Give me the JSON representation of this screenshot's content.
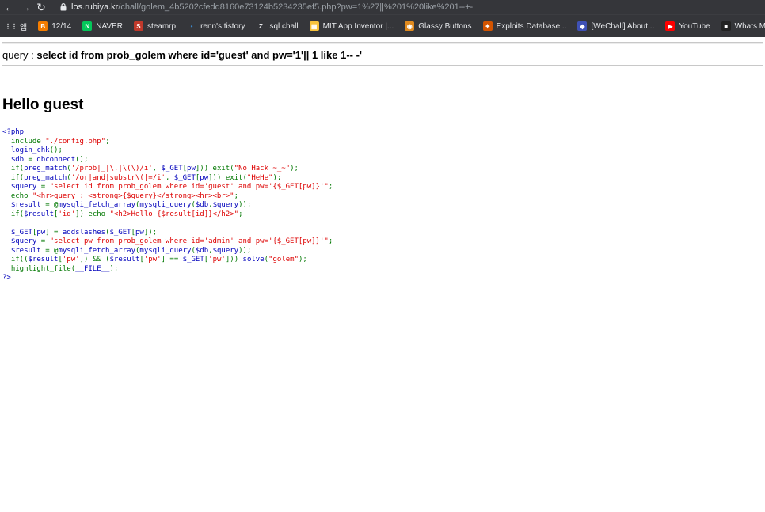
{
  "browser": {
    "url_host": "los.rubiya.kr",
    "url_path": "/chall/golem_4b5202cfedd8160e73124b5234235ef5.php?pw=1%27||%201%20like%201--+-",
    "colors": {
      "chrome_bg": "#35363a",
      "text": "#e8eaed",
      "url_dim": "#9aa0a6"
    }
  },
  "bookmarks": [
    {
      "label": "앱",
      "icon": "apps-grid-icon",
      "color": "#e8eaed"
    },
    {
      "label": "12/14",
      "icon": "blogger-icon",
      "color": "#f57d00"
    },
    {
      "label": "NAVER",
      "icon": "naver-icon",
      "color": "#03c75a"
    },
    {
      "label": "steamrp",
      "icon": "steamrp-icon",
      "color": "#c0392b"
    },
    {
      "label": "renn's tistory",
      "icon": "tistory-icon",
      "color": "#3a86c8"
    },
    {
      "label": "sql chall",
      "icon": "z-icon",
      "color": "#e8eaed"
    },
    {
      "label": "MIT App Inventor |...",
      "icon": "appinventor-icon",
      "color": "#f7c23b"
    },
    {
      "label": "Glassy Buttons",
      "icon": "glassy-icon",
      "color": "#e08a1e"
    },
    {
      "label": "Exploits Database...",
      "icon": "exploitdb-icon",
      "color": "#d35400"
    },
    {
      "label": "[WeChall] About...",
      "icon": "wechall-icon",
      "color": "#3f51b5"
    },
    {
      "label": "YouTube",
      "icon": "youtube-icon",
      "color": "#ff0000"
    },
    {
      "label": "Whats My IP A",
      "icon": "ip-icon",
      "color": "#222222"
    }
  ],
  "page": {
    "query_label": "query : ",
    "query_value": "select id from prob_golem where id='guest' and pw='1'|| 1 like 1-- -'",
    "greeting": "Hello guest"
  },
  "code_lines": [
    [
      [
        "def",
        "<?php"
      ]
    ],
    [
      [
        "def",
        "  "
      ],
      [
        "kw",
        "include "
      ],
      [
        "str",
        "\"./config.php\""
      ],
      [
        "kw",
        ";"
      ]
    ],
    [
      [
        "def",
        "  login_chk"
      ],
      [
        "kw",
        "();"
      ]
    ],
    [
      [
        "def",
        "  $db "
      ],
      [
        "kw",
        "= "
      ],
      [
        "def",
        "dbconnect"
      ],
      [
        "kw",
        "();"
      ]
    ],
    [
      [
        "def",
        "  "
      ],
      [
        "kw",
        "if("
      ],
      [
        "def",
        "preg_match"
      ],
      [
        "kw",
        "("
      ],
      [
        "str",
        "'/prob|_|\\.|\\(\\)/i'"
      ],
      [
        "kw",
        ", "
      ],
      [
        "def",
        "$_GET"
      ],
      [
        "kw",
        "["
      ],
      [
        "def",
        "pw"
      ],
      [
        "kw",
        "])) exit("
      ],
      [
        "str",
        "\"No Hack ~_~\""
      ],
      [
        "kw",
        ");"
      ]
    ],
    [
      [
        "def",
        "  "
      ],
      [
        "kw",
        "if("
      ],
      [
        "def",
        "preg_match"
      ],
      [
        "kw",
        "("
      ],
      [
        "str",
        "'/or|and|substr\\(|=/i'"
      ],
      [
        "kw",
        ", "
      ],
      [
        "def",
        "$_GET"
      ],
      [
        "kw",
        "["
      ],
      [
        "def",
        "pw"
      ],
      [
        "kw",
        "])) exit("
      ],
      [
        "str",
        "\"HeHe\""
      ],
      [
        "kw",
        ");"
      ]
    ],
    [
      [
        "def",
        "  $query "
      ],
      [
        "kw",
        "= "
      ],
      [
        "str",
        "\"select id from prob_golem where id='guest' and pw='{$_GET[pw]}'\""
      ],
      [
        "kw",
        ";"
      ]
    ],
    [
      [
        "def",
        "  "
      ],
      [
        "kw",
        "echo "
      ],
      [
        "str",
        "\"<hr>query : <strong>{$query}</strong><hr><br>\""
      ],
      [
        "kw",
        ";"
      ]
    ],
    [
      [
        "def",
        "  $result "
      ],
      [
        "kw",
        "= @"
      ],
      [
        "def",
        "mysqli_fetch_array"
      ],
      [
        "kw",
        "("
      ],
      [
        "def",
        "mysqli_query"
      ],
      [
        "kw",
        "("
      ],
      [
        "def",
        "$db"
      ],
      [
        "kw",
        ","
      ],
      [
        "def",
        "$query"
      ],
      [
        "kw",
        "));"
      ]
    ],
    [
      [
        "def",
        "  "
      ],
      [
        "kw",
        "if("
      ],
      [
        "def",
        "$result"
      ],
      [
        "kw",
        "["
      ],
      [
        "str",
        "'id'"
      ],
      [
        "kw",
        "]) echo "
      ],
      [
        "str",
        "\"<h2>Hello {$result[id]}</h2>\""
      ],
      [
        "kw",
        ";"
      ]
    ],
    [
      [
        "def",
        ""
      ]
    ],
    [
      [
        "def",
        "  $_GET"
      ],
      [
        "kw",
        "["
      ],
      [
        "def",
        "pw"
      ],
      [
        "kw",
        "] = "
      ],
      [
        "def",
        "addslashes"
      ],
      [
        "kw",
        "("
      ],
      [
        "def",
        "$_GET"
      ],
      [
        "kw",
        "["
      ],
      [
        "def",
        "pw"
      ],
      [
        "kw",
        "]);"
      ]
    ],
    [
      [
        "def",
        "  $query "
      ],
      [
        "kw",
        "= "
      ],
      [
        "str",
        "\"select pw from prob_golem where id='admin' and pw='{$_GET[pw]}'\""
      ],
      [
        "kw",
        ";"
      ]
    ],
    [
      [
        "def",
        "  $result "
      ],
      [
        "kw",
        "= @"
      ],
      [
        "def",
        "mysqli_fetch_array"
      ],
      [
        "kw",
        "("
      ],
      [
        "def",
        "mysqli_query"
      ],
      [
        "kw",
        "("
      ],
      [
        "def",
        "$db"
      ],
      [
        "kw",
        ","
      ],
      [
        "def",
        "$query"
      ],
      [
        "kw",
        "));"
      ]
    ],
    [
      [
        "def",
        "  "
      ],
      [
        "kw",
        "if(("
      ],
      [
        "def",
        "$result"
      ],
      [
        "kw",
        "["
      ],
      [
        "str",
        "'pw'"
      ],
      [
        "kw",
        "]) && ("
      ],
      [
        "def",
        "$result"
      ],
      [
        "kw",
        "["
      ],
      [
        "str",
        "'pw'"
      ],
      [
        "kw",
        "] == "
      ],
      [
        "def",
        "$_GET"
      ],
      [
        "kw",
        "["
      ],
      [
        "str",
        "'pw'"
      ],
      [
        "kw",
        "])) "
      ],
      [
        "def",
        "solve"
      ],
      [
        "kw",
        "("
      ],
      [
        "str",
        "\"golem\""
      ],
      [
        "kw",
        ");"
      ]
    ],
    [
      [
        "def",
        "  "
      ],
      [
        "kw",
        "highlight_file"
      ],
      [
        "kw",
        "("
      ],
      [
        "def",
        "__FILE__"
      ],
      [
        "kw",
        ");"
      ]
    ],
    [
      [
        "def",
        "?>"
      ]
    ]
  ]
}
